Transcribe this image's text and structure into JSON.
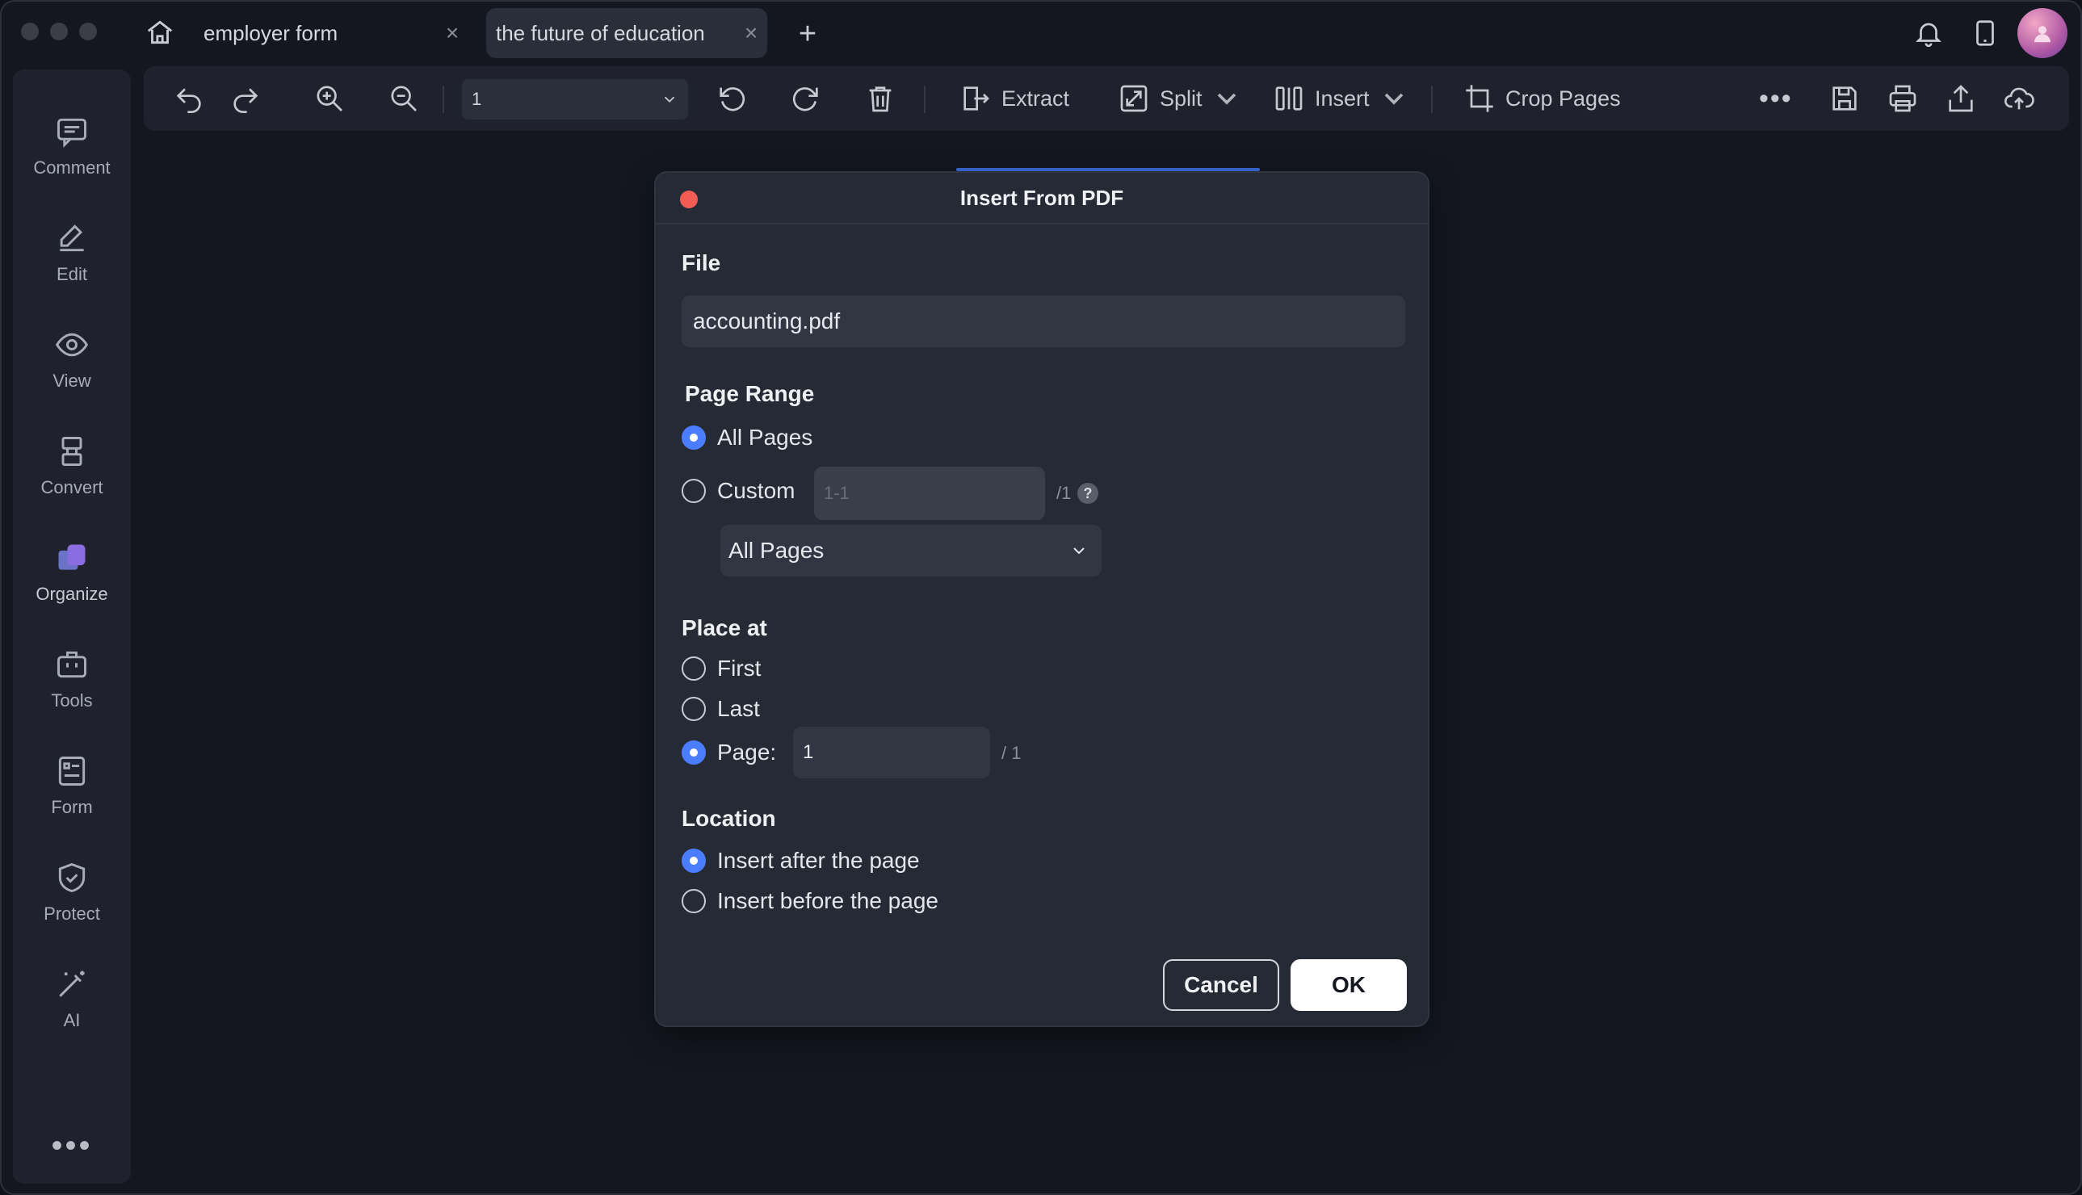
{
  "titlebar": {
    "tabs": [
      {
        "label": "employer form",
        "close": "×"
      },
      {
        "label": "the future of education",
        "close": "×"
      }
    ],
    "new_tab": "+",
    "icons": [
      "home-icon",
      "bell-icon",
      "tablet-icon",
      "avatar"
    ]
  },
  "sidebar": {
    "items": [
      {
        "label": "Comment",
        "icon": "comment-icon"
      },
      {
        "label": "Edit",
        "icon": "edit-icon"
      },
      {
        "label": "View",
        "icon": "eye-icon"
      },
      {
        "label": "Convert",
        "icon": "convert-icon"
      },
      {
        "label": "Organize",
        "icon": "organize-icon"
      },
      {
        "label": "Tools",
        "icon": "toolbox-icon"
      },
      {
        "label": "Form",
        "icon": "form-icon"
      },
      {
        "label": "Protect",
        "icon": "shield-icon"
      },
      {
        "label": "AI",
        "icon": "magic-wand-icon"
      }
    ],
    "more": "•••"
  },
  "toolbar": {
    "page_value": "1",
    "extract": "Extract",
    "split": "Split",
    "insert": "Insert",
    "crop_pages": "Crop Pages",
    "more": "•••"
  },
  "dialog": {
    "title": "Insert From PDF",
    "file_label": "File",
    "file_value": "accounting.pdf",
    "page_range_label": "Page Range",
    "all_pages": "All Pages",
    "custom": "Custom",
    "custom_placeholder": "1-1",
    "custom_total": "/1",
    "help": "?",
    "pages_dropdown": "All Pages",
    "place_at_label": "Place at",
    "first": "First",
    "last": "Last",
    "page_label": "Page:",
    "page_value": "1",
    "page_total": "/ 1",
    "location_label": "Location",
    "insert_after": "Insert after the page",
    "insert_before": "Insert before the page",
    "cancel": "Cancel",
    "ok": "OK",
    "selected": {
      "page_range": "All Pages",
      "place_at": "Page",
      "location": "Insert after the page"
    }
  },
  "colors": {
    "accent": "#4a7dff",
    "close_dot": "#f25c54",
    "avatar": "#b05aa5"
  }
}
